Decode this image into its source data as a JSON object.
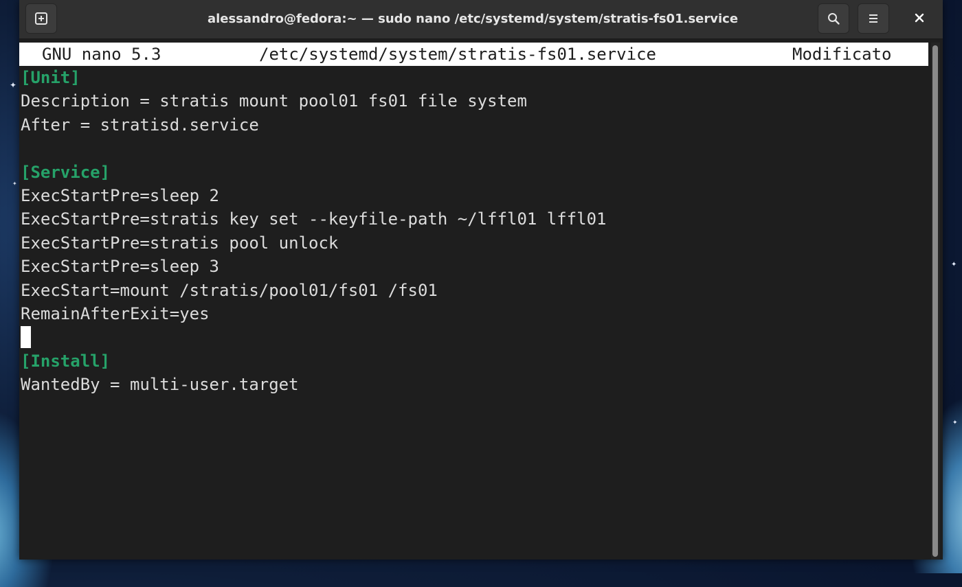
{
  "window": {
    "title": "alessandro@fedora:~ — sudo nano /etc/systemd/system/stratis-fs01.service"
  },
  "headerbar": {
    "new_tab_icon": "new-tab-icon",
    "search_icon": "search-icon",
    "menu_icon": "hamburger-menu-icon",
    "close_icon": "close-icon"
  },
  "nano": {
    "version": "GNU nano 5.3",
    "filename": "/etc/systemd/system/stratis-fs01.service",
    "status": "Modificato"
  },
  "editor": {
    "lines": [
      "[Unit]",
      "Description = stratis mount pool01 fs01 file system",
      "After = stratisd.service",
      "",
      "[Service]",
      "ExecStartPre=sleep 2",
      "ExecStartPre=stratis key set --keyfile-path ~/lffl01 lffl01",
      "ExecStartPre=stratis pool unlock",
      "ExecStartPre=sleep 3",
      "ExecStart=mount /stratis/pool01/fs01 /fs01",
      "RemainAfterExit=yes",
      "",
      "[Install]",
      "WantedBy = multi-user.target"
    ]
  },
  "colors": {
    "section_header": "#26a269",
    "terminal_background": "#1e1e1e",
    "terminal_text": "#dcdcdc",
    "headerbar_background": "#303030",
    "nano_titlebar_background": "#ffffff"
  }
}
